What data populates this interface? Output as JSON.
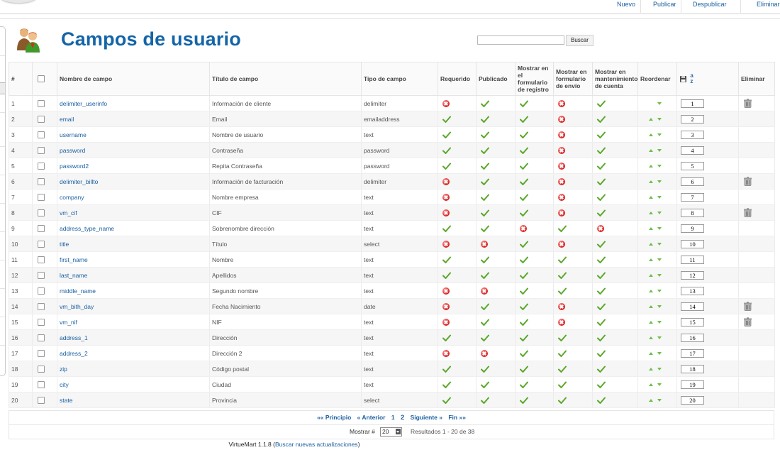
{
  "toolbar": {
    "nuevo": "Nuevo",
    "publicar": "Publicar",
    "despublicar": "Despublicar",
    "eliminar": "Eliminar"
  },
  "header": {
    "title": "Campos de usuario"
  },
  "search": {
    "value": "",
    "button": "Buscar"
  },
  "columns": {
    "num": "#",
    "name": "Nombre de campo",
    "title": "Título de campo",
    "type": "Tipo de campo",
    "required": "Requerido",
    "published": "Publicado",
    "registration": "Mostrar en el formulario de registro",
    "shipping": "Mostrar en formulario de envío",
    "account": "Mostrar en mantenimiento de cuenta",
    "reorder": "Reordenar",
    "delete": "Eliminar"
  },
  "rows": [
    {
      "num": "1",
      "name": "delimiter_userinfo",
      "title": "Información de cliente",
      "type": "delimiter",
      "req": false,
      "pub": true,
      "reg": true,
      "ship": false,
      "acct": true,
      "up": false,
      "down": true,
      "order": "1",
      "del": true
    },
    {
      "num": "2",
      "name": "email",
      "title": "Email",
      "type": "emailaddress",
      "req": true,
      "pub": true,
      "reg": true,
      "ship": false,
      "acct": true,
      "up": true,
      "down": true,
      "order": "2",
      "del": false
    },
    {
      "num": "3",
      "name": "username",
      "title": "Nombre de usuario",
      "type": "text",
      "req": true,
      "pub": true,
      "reg": true,
      "ship": false,
      "acct": true,
      "up": true,
      "down": true,
      "order": "3",
      "del": false
    },
    {
      "num": "4",
      "name": "password",
      "title": "Contraseña",
      "type": "password",
      "req": true,
      "pub": true,
      "reg": true,
      "ship": false,
      "acct": true,
      "up": true,
      "down": true,
      "order": "4",
      "del": false
    },
    {
      "num": "5",
      "name": "password2",
      "title": "Repita Contraseña",
      "type": "password",
      "req": true,
      "pub": true,
      "reg": true,
      "ship": false,
      "acct": true,
      "up": true,
      "down": true,
      "order": "5",
      "del": false
    },
    {
      "num": "6",
      "name": "delimiter_billto",
      "title": "Información de facturación",
      "type": "delimiter",
      "req": false,
      "pub": true,
      "reg": true,
      "ship": false,
      "acct": true,
      "up": true,
      "down": true,
      "order": "6",
      "del": true
    },
    {
      "num": "7",
      "name": "company",
      "title": "Nombre empresa",
      "type": "text",
      "req": false,
      "pub": true,
      "reg": true,
      "ship": false,
      "acct": true,
      "up": true,
      "down": true,
      "order": "7",
      "del": false
    },
    {
      "num": "8",
      "name": "vm_cif",
      "title": "CIF",
      "type": "text",
      "req": false,
      "pub": true,
      "reg": true,
      "ship": false,
      "acct": true,
      "up": true,
      "down": true,
      "order": "8",
      "del": true
    },
    {
      "num": "9",
      "name": "address_type_name",
      "title": "Sobrenombre dirección",
      "type": "text",
      "req": true,
      "pub": true,
      "reg": false,
      "ship": true,
      "acct": false,
      "up": true,
      "down": true,
      "order": "9",
      "del": false
    },
    {
      "num": "10",
      "name": "title",
      "title": "Título",
      "type": "select",
      "req": false,
      "pub": false,
      "reg": true,
      "ship": false,
      "acct": true,
      "up": true,
      "down": true,
      "order": "10",
      "del": false
    },
    {
      "num": "11",
      "name": "first_name",
      "title": "Nombre",
      "type": "text",
      "req": true,
      "pub": true,
      "reg": true,
      "ship": true,
      "acct": true,
      "up": true,
      "down": true,
      "order": "11",
      "del": false
    },
    {
      "num": "12",
      "name": "last_name",
      "title": "Apellidos",
      "type": "text",
      "req": true,
      "pub": true,
      "reg": true,
      "ship": true,
      "acct": true,
      "up": true,
      "down": true,
      "order": "12",
      "del": false
    },
    {
      "num": "13",
      "name": "middle_name",
      "title": "Segundo nombre",
      "type": "text",
      "req": false,
      "pub": false,
      "reg": true,
      "ship": true,
      "acct": true,
      "up": true,
      "down": true,
      "order": "13",
      "del": false
    },
    {
      "num": "14",
      "name": "vm_bith_day",
      "title": "Fecha Nacimiento",
      "type": "date",
      "req": false,
      "pub": true,
      "reg": true,
      "ship": false,
      "acct": true,
      "up": true,
      "down": true,
      "order": "14",
      "del": true
    },
    {
      "num": "15",
      "name": "vm_nif",
      "title": "NIF",
      "type": "text",
      "req": false,
      "pub": true,
      "reg": true,
      "ship": false,
      "acct": true,
      "up": true,
      "down": true,
      "order": "15",
      "del": true
    },
    {
      "num": "16",
      "name": "address_1",
      "title": "Dirección",
      "type": "text",
      "req": true,
      "pub": true,
      "reg": true,
      "ship": true,
      "acct": true,
      "up": true,
      "down": true,
      "order": "16",
      "del": false
    },
    {
      "num": "17",
      "name": "address_2",
      "title": "Dirección 2",
      "type": "text",
      "req": false,
      "pub": false,
      "reg": true,
      "ship": true,
      "acct": true,
      "up": true,
      "down": true,
      "order": "17",
      "del": false
    },
    {
      "num": "18",
      "name": "zip",
      "title": "Código postal",
      "type": "text",
      "req": true,
      "pub": true,
      "reg": true,
      "ship": true,
      "acct": true,
      "up": true,
      "down": true,
      "order": "18",
      "del": false
    },
    {
      "num": "19",
      "name": "city",
      "title": "Ciudad",
      "type": "text",
      "req": true,
      "pub": true,
      "reg": true,
      "ship": true,
      "acct": true,
      "up": true,
      "down": true,
      "order": "19",
      "del": false
    },
    {
      "num": "20",
      "name": "state",
      "title": "Provincia",
      "type": "select",
      "req": true,
      "pub": true,
      "reg": true,
      "ship": true,
      "acct": true,
      "up": true,
      "down": true,
      "order": "20",
      "del": false
    }
  ],
  "pagination": {
    "first": "«« Principio",
    "prev": "« Anterior",
    "page1": "1",
    "page2": "2",
    "next": "Siguiente »",
    "last": "Fin »»"
  },
  "limit": {
    "label": "Mostrar #",
    "value": "20",
    "results": "Resultados 1 - 20 de 38"
  },
  "footer": {
    "version": "VirtueMart 1.1.8 (",
    "link": "Buscar nuevas actualizaciones",
    "close": ")"
  },
  "colors": {
    "link": "#1a5fa0",
    "title": "#1465a8",
    "ok": "#5aa82a",
    "error": "#d81b1b"
  }
}
